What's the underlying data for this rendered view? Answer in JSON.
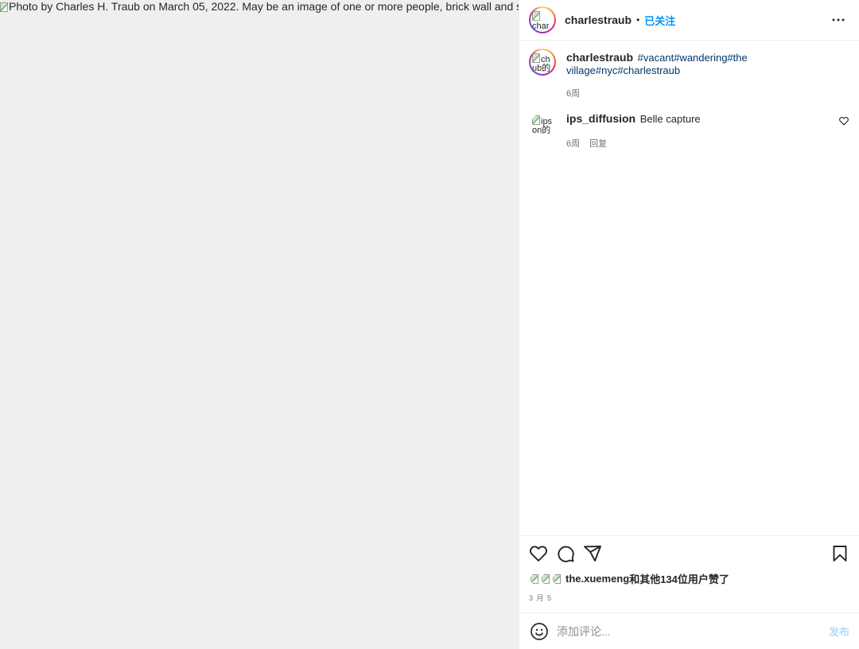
{
  "media": {
    "alt_text": "Photo by Charles H. Traub on March 05, 2022. May be an image of one or more people, brick wall and street."
  },
  "header": {
    "username": "charlestraub",
    "avatar_alt": "char",
    "separator": "•",
    "follow_status": "已关注"
  },
  "caption": {
    "avatar_alt": "ch ub的",
    "username": "charlestraub",
    "hashtags_line1": "#vacant#wandering#the",
    "hashtags_line2": "village#nyc#charlestraub",
    "time": "6周"
  },
  "comments": [
    {
      "avatar_alt": "ips on的",
      "username": "ips_diffusion",
      "text": "Belle capture",
      "time": "6周",
      "reply_label": "回复"
    }
  ],
  "likes": {
    "liker_username": "the.xuemeng",
    "suffix": "和其他134位用户赞了"
  },
  "post_date": "3 月 5",
  "add_comment": {
    "placeholder": "添加评论...",
    "post_label": "发布"
  },
  "colors": {
    "link_blue": "#0095f6",
    "hashtag_blue": "#00376b",
    "muted": "#737373",
    "post_disabled": "#b2dffc"
  }
}
